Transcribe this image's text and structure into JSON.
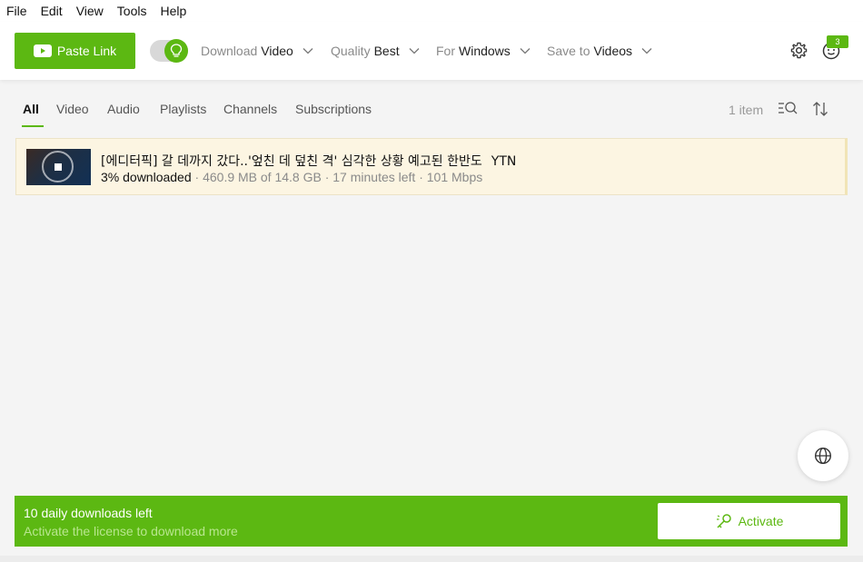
{
  "menu": [
    "File",
    "Edit",
    "View",
    "Tools",
    "Help"
  ],
  "toolbar": {
    "paste_label": "Paste Link",
    "download_label": "Download",
    "download_value": "Video",
    "quality_label": "Quality",
    "quality_value": "Best",
    "for_label": "For",
    "for_value": "Windows",
    "save_label": "Save to",
    "save_value": "Videos",
    "notification_count": "3",
    "accent_color": "#5cb812"
  },
  "tabs": [
    "All",
    "Video",
    "Audio",
    "Playlists",
    "Channels",
    "Subscriptions"
  ],
  "list": {
    "count": "1 item"
  },
  "item": {
    "title": "[에디터픽] 갈 데까지 갔다..'엎친 데 덮친 격' 심각한 상황 예고된 한반도",
    "channel": "YTN",
    "progress": "3% downloaded",
    "meta": " · 460.9 MB of 14.8 GB · 17 minutes left · 101 Mbps"
  },
  "banner": {
    "line1": "10 daily downloads left",
    "line2": "Activate the license to download more",
    "activate_label": "Activate"
  }
}
